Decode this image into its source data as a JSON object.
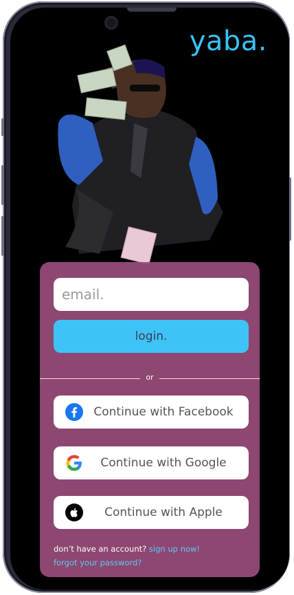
{
  "app": {
    "logo_text": "yaba."
  },
  "login_form": {
    "email_placeholder": "email.",
    "login_label": "login.",
    "divider_text": "or"
  },
  "social": {
    "facebook_label": "Continue with Facebook",
    "google_label": "Continue with Google",
    "apple_label": "Continue with Apple"
  },
  "footer": {
    "no_account_text": "don’t have an account?",
    "signup_link": "sign up now!",
    "forgot_link": "forgot your password?"
  },
  "colors": {
    "accent": "#3ec3f7",
    "card": "#994c7a",
    "facebook": "#1877f2"
  }
}
